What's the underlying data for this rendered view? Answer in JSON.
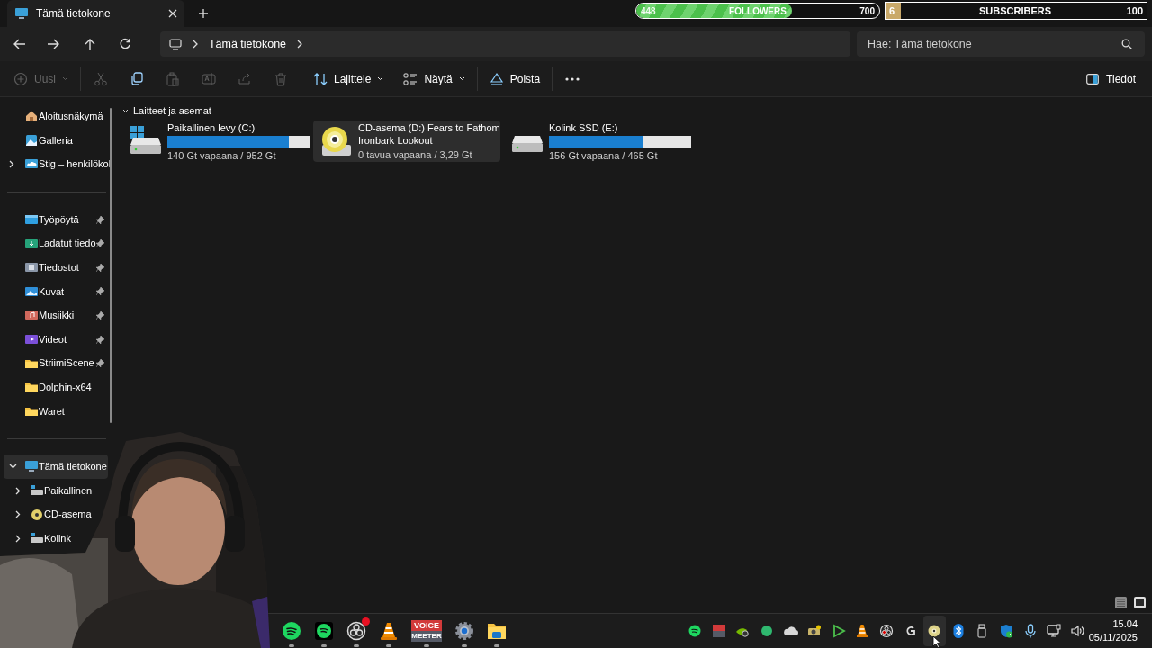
{
  "tabs": [
    {
      "title": "Tämä tietokone",
      "selected": true
    }
  ],
  "stream_overlay": {
    "followers": {
      "current": "448",
      "label": "FOLLOWERS",
      "goal": "700",
      "level": 0.64
    },
    "subscribers": {
      "current": "6",
      "label": "SUBSCRIBERS",
      "goal": "100",
      "level": 0.06
    }
  },
  "address_bar": {
    "segments": [
      "Tämä tietokone"
    ]
  },
  "search": {
    "placeholder": "Hae: Tämä tietokone"
  },
  "toolbar": {
    "groups": [
      [
        {
          "kind": "new",
          "label": "Uusi",
          "dropdown": true,
          "disabled": true
        }
      ],
      [
        {
          "kind": "cut",
          "dropdown": false,
          "disabled": true
        },
        {
          "kind": "copy",
          "dropdown": false,
          "disabled": false
        },
        {
          "kind": "paste",
          "dropdown": false,
          "disabled": true
        },
        {
          "kind": "rename",
          "dropdown": false,
          "disabled": true
        },
        {
          "kind": "share",
          "dropdown": false,
          "disabled": true
        },
        {
          "kind": "delete",
          "dropdown": false,
          "disabled": true
        }
      ],
      [
        {
          "kind": "sort",
          "label": "Lajittele",
          "dropdown": true,
          "disabled": false
        },
        {
          "kind": "view",
          "label": "Näytä",
          "dropdown": true,
          "disabled": false
        }
      ],
      [
        {
          "kind": "eject",
          "label": "Poista",
          "dropdown": false,
          "disabled": false
        }
      ],
      [
        {
          "kind": "more",
          "dropdown": false,
          "disabled": false
        }
      ]
    ]
  },
  "details_button": {
    "label": "Tiedot"
  },
  "sidebar": {
    "sections": [
      [
        {
          "label": "Aloitusnäkymä",
          "kind": "home",
          "selected": false
        },
        {
          "label": "Galleria",
          "kind": "gallery",
          "selected": false
        },
        {
          "label": "Stig – henkilökol",
          "kind": "cloud",
          "selected": false,
          "expanded": false
        }
      ],
      [
        {
          "label": "Työpöytä",
          "kind": "desktop",
          "pinned": true,
          "selected": false
        },
        {
          "label": "Ladatut tiedo",
          "kind": "downloads",
          "pinned": true,
          "selected": false
        },
        {
          "label": "Tiedostot",
          "kind": "documents",
          "pinned": true,
          "selected": false
        },
        {
          "label": "Kuvat",
          "kind": "pictures",
          "pinned": true,
          "selected": false
        },
        {
          "label": "Musiikki",
          "kind": "music",
          "pinned": true,
          "selected": false
        },
        {
          "label": "Videot",
          "kind": "videos",
          "pinned": true,
          "selected": false
        },
        {
          "label": "StriimiScene",
          "kind": "folder",
          "pinned": true,
          "selected": false
        },
        {
          "label": "Dolphin-x64",
          "kind": "folder",
          "pinned": false,
          "selected": false
        },
        {
          "label": "Waret",
          "kind": "folder",
          "pinned": false,
          "selected": false
        }
      ],
      [
        {
          "label": "Tämä tietokone",
          "kind": "pc",
          "selected": true,
          "expanded": true,
          "children": [
            {
              "label": "Paikallinen",
              "kind": "drive",
              "selected": false,
              "expanded": false
            },
            {
              "label": "CD-asema",
              "kind": "cd",
              "selected": false,
              "expanded": false
            },
            {
              "label": "Kolink",
              "kind": "drive",
              "selected": false,
              "expanded": false
            }
          ]
        }
      ]
    ]
  },
  "drives_section": {
    "title": "Laitteet ja asemat",
    "expanded": true,
    "drives": [
      {
        "kind": "system",
        "name": "Paikallinen levy (C:)",
        "free": "140 Gt vapaana / 952 Gt",
        "level": 0.853,
        "selected": false
      },
      {
        "kind": "cd",
        "name": "CD-asema (D:) Fears to Fathom Ironbark Lookout",
        "free": "0 tavua vapaana / 3,29 Gt",
        "selected": true
      },
      {
        "kind": "drive",
        "name": "Kolink SSD (E:)",
        "free": "156 Gt vapaana / 465 Gt",
        "level": 0.665,
        "selected": false
      }
    ]
  },
  "view_buttons": [
    {
      "kind": "details",
      "selected": false
    },
    {
      "kind": "tiles",
      "selected": true
    }
  ],
  "taskbar": {
    "apps": [
      {
        "kind": "spotify",
        "running": true,
        "badge": false
      },
      {
        "kind": "spotify-square",
        "running": true,
        "badge": false
      },
      {
        "kind": "obs",
        "running": true,
        "badge": true
      },
      {
        "kind": "vlc",
        "running": true,
        "badge": false
      },
      {
        "kind": "voicemeeter",
        "label_top": "VOICE",
        "label_bottom": "MEETER",
        "running": true,
        "badge": false
      },
      {
        "kind": "settings",
        "running": true,
        "badge": false
      },
      {
        "kind": "explorer",
        "running": true,
        "badge": false
      }
    ],
    "tray": [
      {
        "kind": "spotify",
        "hovered": false
      },
      {
        "kind": "voicemeeter",
        "hovered": false
      },
      {
        "kind": "nvidia",
        "hovered": false
      },
      {
        "kind": "circle",
        "hovered": false
      },
      {
        "kind": "cloud",
        "hovered": false
      },
      {
        "kind": "camera",
        "hovered": false
      },
      {
        "kind": "play",
        "hovered": false
      },
      {
        "kind": "vlc",
        "hovered": false
      },
      {
        "kind": "obs",
        "hovered": false
      },
      {
        "kind": "g",
        "hovered": false
      },
      {
        "kind": "cd",
        "hovered": true
      },
      {
        "kind": "bluetooth",
        "hovered": false
      },
      {
        "kind": "usb",
        "hovered": false
      },
      {
        "kind": "shield",
        "hovered": false
      },
      {
        "kind": "mic",
        "hovered": false
      },
      {
        "kind": "display",
        "hovered": false
      },
      {
        "kind": "volume",
        "hovered": false
      }
    ],
    "clock": {
      "time": "15.04",
      "date": "05/11/2025"
    }
  }
}
